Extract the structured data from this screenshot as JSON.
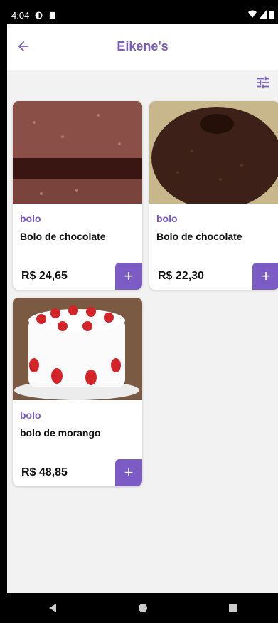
{
  "status_bar": {
    "time": "4:04"
  },
  "app_bar": {
    "title": "Eikene's"
  },
  "products": [
    {
      "category": "bolo",
      "name": "Bolo de chocolate",
      "price": "R$ 24,65",
      "add_label": "+"
    },
    {
      "category": "bolo",
      "name": "Bolo de chocolate",
      "price": "R$ 22,30",
      "add_label": "+"
    },
    {
      "category": "bolo",
      "name": "bolo de morango",
      "price": "R$ 48,85",
      "add_label": "+"
    }
  ],
  "colors": {
    "accent": "#7c5cc4",
    "background": "#f2f2f2"
  }
}
